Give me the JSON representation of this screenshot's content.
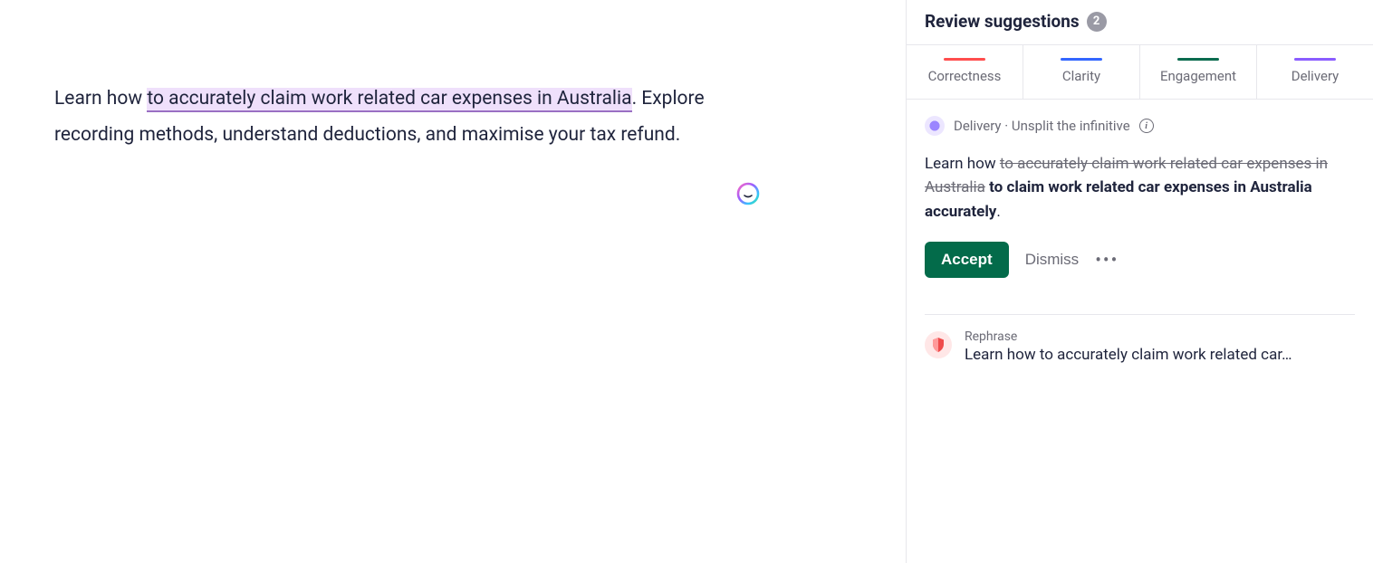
{
  "editor": {
    "prefix": "Learn how ",
    "highlight": "to accurately claim work related car expenses in Australia",
    "suffix": ". Explore recording methods, understand deductions, and maximise your tax refund."
  },
  "sidebar": {
    "title": "Review suggestions",
    "count": "2",
    "tabs": {
      "correctness": "Correctness",
      "clarity": "Clarity",
      "engagement": "Engagement",
      "delivery": "Delivery"
    }
  },
  "suggestion": {
    "category": "Delivery · Unsplit the infinitive",
    "text_prefix": "Learn how ",
    "text_strike": "to accurately claim work related car expenses in Australia",
    "text_insert": " to claim work related car expenses in Australia accurately",
    "text_suffix": ".",
    "accept_label": "Accept",
    "dismiss_label": "Dismiss"
  },
  "rephrase": {
    "label": "Rephrase",
    "preview": "Learn how to accurately claim work related car…"
  }
}
